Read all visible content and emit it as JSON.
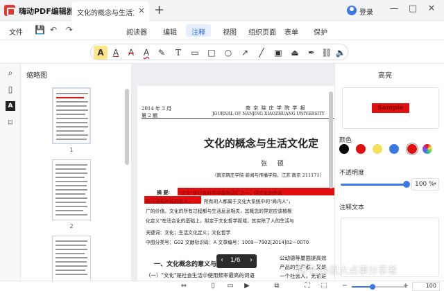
{
  "app": {
    "name": "嗨动PDF编辑器",
    "login_label": "登录"
  },
  "tab": {
    "label": "文化的概念与生活文化...",
    "close": "×",
    "new": "+"
  },
  "window": {
    "minimize": "—",
    "maximize": "□",
    "close": "✕"
  },
  "menu": {
    "file": "文件",
    "items": [
      "阅读器",
      "编辑",
      "注释",
      "视图",
      "组织页面",
      "表单",
      "保护"
    ],
    "active": "注释"
  },
  "annotation_tools": [
    "highlight",
    "underline",
    "strikethrough",
    "squiggly",
    "pencil",
    "text",
    "comment",
    "rectangle",
    "ellipse",
    "arrow",
    "line",
    "image",
    "stamp",
    "signature",
    "link",
    "audio"
  ],
  "sidebar": {
    "thumbnails_title": "缩略图",
    "page_numbers": [
      "1",
      "2"
    ]
  },
  "document": {
    "date": "2014 年 3 月",
    "issue": "第 2 期",
    "journal_cn": "南 京 晓 庄 学 院 学 报",
    "journal_en": "JOURNAL OF NANJING XIAOZHUANG UNIVERSITY",
    "title": "文化的概念与生活文化定",
    "author": "张 硕",
    "affiliation": "（南京晓庄学院 新闻与传播学院，江苏 南京 211171）",
    "abstract_label": "摘 要:",
    "abstract_lines": [
      "\"文化\"是社会科学中最热词汇之一，但文化的外延",
      "的内涵和外延的定义。",
      "所有的人都属于文化大系统中的\"局内人\"，",
      "广的价值。文化的所有过程都与生活息息相关，其概念的界定应该植根",
      "化定义\"在适合化的基础上，拟定于文化哲学视域，其实除了人的生活与"
    ],
    "keywords": "关键词：文化；生活文化定义；文化哲学",
    "classification": "中图分类号：G02    文献标识码：A    文章编号：1009－7902[2014]02－0070",
    "section_heading": "一、文化概念的意义与价值",
    "subsection": "（一）\"文化\"是社会生活中使用频率最高的词语",
    "right_col": [
      "公动德等厦面提高效",
      "产品的生产者，又是",
      "一个社会人，无论是"
    ],
    "pager": {
      "label": "1/6",
      "prev": "‹",
      "next": "›"
    }
  },
  "properties": {
    "title": "高亮",
    "sample_text": "Sample",
    "color_label": "颜色",
    "colors": [
      "#000000",
      "#e01010",
      "#f5e05a",
      "#3b78e7",
      "#e01010"
    ],
    "opacity_label": "不透明度",
    "opacity_value": "100 %",
    "note_label": "注释文本"
  },
  "statusbar": {
    "zoom_value": "100"
  },
  "watermark": "知乎 @屁大点事分享者"
}
